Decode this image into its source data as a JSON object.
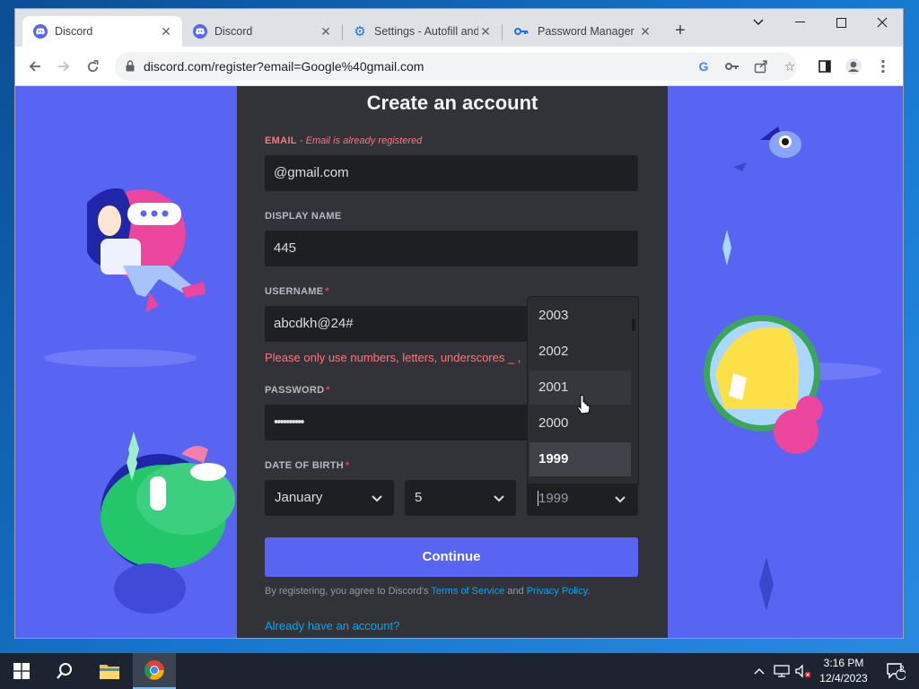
{
  "browser": {
    "tabs": [
      {
        "title": "Discord",
        "icon": "discord-icon",
        "active": true
      },
      {
        "title": "Discord",
        "icon": "discord-icon",
        "active": false
      },
      {
        "title": "Settings - Autofill and",
        "icon": "gear-icon",
        "active": false
      },
      {
        "title": "Password Manager",
        "icon": "key-icon",
        "active": false
      }
    ],
    "url": "discord.com/register?email=Google%40gmail.com"
  },
  "form": {
    "heading": "Create an account",
    "email": {
      "label": "EMAIL",
      "error": "- Email is already registered",
      "value": "@gmail.com"
    },
    "display_name": {
      "label": "DISPLAY NAME",
      "value": "445"
    },
    "username": {
      "label": "USERNAME",
      "required": "*",
      "value": "abcdkh@24#",
      "error": "Please only use numbers, letters, underscores _ ,"
    },
    "password": {
      "label": "PASSWORD",
      "required": "*",
      "value": "••••••••••"
    },
    "dob": {
      "label": "DATE OF BIRTH",
      "required": "*",
      "month": "January",
      "day": "5",
      "year": "1999"
    },
    "year_options": [
      "2003",
      "2002",
      "2001",
      "2000",
      "1999"
    ],
    "hovered_year": "2001",
    "selected_year": "1999",
    "continue_label": "Continue",
    "legal_prefix": "By registering, you agree to Discord's ",
    "terms_label": "Terms of Service",
    "and_text": " and ",
    "privacy_label": "Privacy Policy",
    "legal_suffix": ".",
    "login_link": "Already have an account?"
  },
  "taskbar": {
    "time": "3:16 PM",
    "date": "12/4/2023",
    "notification_count": "2"
  },
  "colors": {
    "discord_blurple": "#5865f2",
    "card_bg": "#313338",
    "input_bg": "#1e1f22",
    "error": "#fa777c",
    "link": "#00a8fc"
  }
}
